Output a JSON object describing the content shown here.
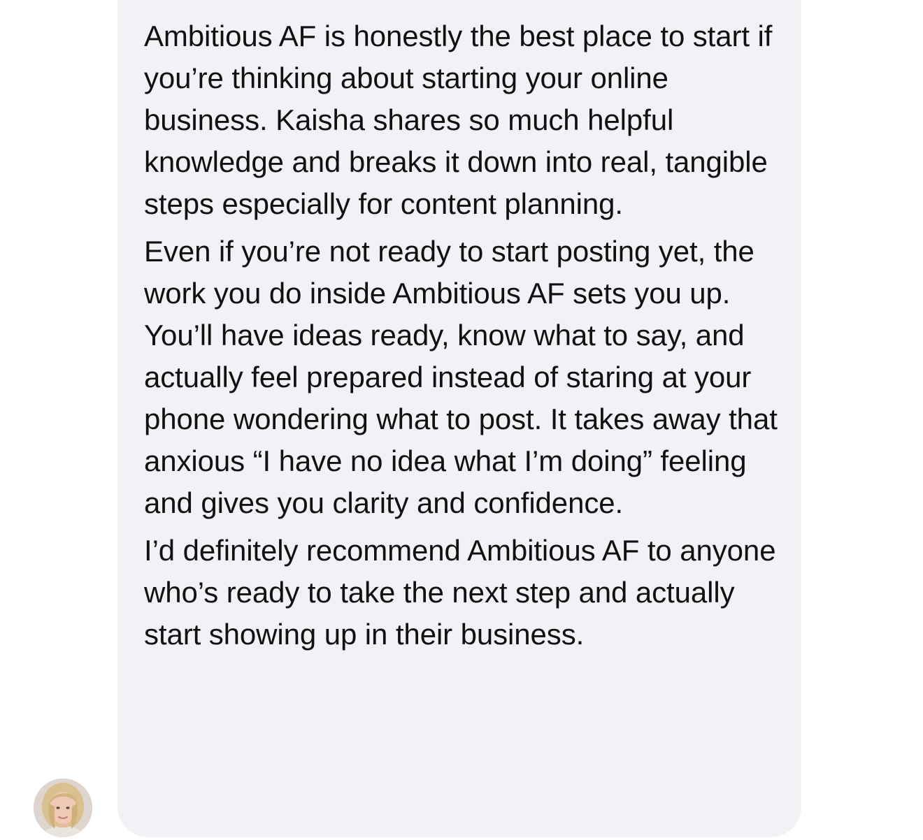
{
  "message": {
    "paragraphs": [
      "Ambitious AF is honestly the best place to start if you’re thinking about starting your online business. Kaisha shares so much helpful knowledge and breaks it down into real, tangible steps especially for content planning.",
      "Even if you’re not ready to start posting yet, the work you do inside Ambitious AF sets you up. You’ll have ideas ready, know what to say, and actually feel prepared instead of staring at your phone wondering what to post. It takes away that anxious “I have no idea what I’m doing” feeling and gives you clarity and confidence.",
      "I’d definitely recommend Ambitious AF to anyone who’s ready to take the next step and actually start showing up in their business."
    ]
  },
  "sender": {
    "avatar_icon": "user-avatar-photo"
  },
  "colors": {
    "bubble_background": "#f1f2f6",
    "text": "#111111"
  }
}
